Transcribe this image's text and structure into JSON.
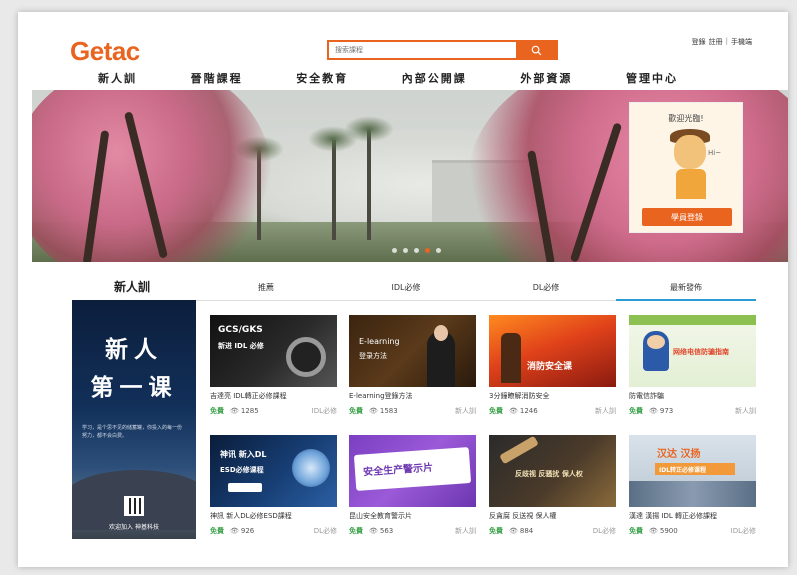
{
  "header": {
    "logo": "Getac",
    "search_placeholder": "搜索課程",
    "user_links": [
      "登錄",
      "註冊",
      "手機端"
    ]
  },
  "nav": [
    "新人訓",
    "晉階課程",
    "安全教育",
    "內部公開課",
    "外部資源",
    "管理中心"
  ],
  "banner": {
    "welcome_title": "歡迎光臨!",
    "hi": "Hi~",
    "login_button": "學員登錄",
    "dots": 5,
    "active_dot": 3
  },
  "section": {
    "title": "新人訓",
    "tabs": [
      "推薦",
      "IDL必修",
      "DL必修",
      "最新發佈"
    ],
    "active_tab": 3
  },
  "poster": {
    "line1": "新人",
    "line2": "第一课",
    "small_text": "学习，是个思不见的储蓄罐，你投入的每一份努力，都不会白费。",
    "footer": "欢迎加入  神基科技"
  },
  "courses": [
    {
      "title": "吉達亮 IDL轉正必修課程",
      "price": "免費",
      "views": "1285",
      "category": "IDL必修",
      "thumb_line1": "GCS/GKS",
      "thumb_line2": "新进 IDL 必修"
    },
    {
      "title": "E-learning登錄方法",
      "price": "免費",
      "views": "1583",
      "category": "新人訓",
      "thumb_line1": "E-learning",
      "thumb_line2": "登录方法"
    },
    {
      "title": "3分鐘瞭解消防安全",
      "price": "免費",
      "views": "1246",
      "category": "新人訓",
      "thumb_line1": "消防安全课",
      "thumb_line2": ""
    },
    {
      "title": "防電信詐騙",
      "price": "免費",
      "views": "973",
      "category": "新人訓",
      "thumb_line1": "网络电信防骗指南",
      "thumb_line2": ""
    },
    {
      "title": "神訊 新人DL必修ESD課程",
      "price": "免費",
      "views": "926",
      "category": "DL必修",
      "thumb_line1": "神讯 新入DL",
      "thumb_line2": "ESD必修课程"
    },
    {
      "title": "昆山安全教育警示片",
      "price": "免費",
      "views": "563",
      "category": "新人訓",
      "thumb_line1": "安全生产警示片",
      "thumb_line2": ""
    },
    {
      "title": "反貪腐 反送視 保人權",
      "price": "免費",
      "views": "884",
      "category": "DL必修",
      "thumb_line1": "反歧视 反骚扰 保人权",
      "thumb_line2": ""
    },
    {
      "title": "漢達 漢揚 IDL 轉正必修課程",
      "price": "免費",
      "views": "5900",
      "category": "IDL必修",
      "thumb_line1": "汉达 汉扬",
      "thumb_line2": "IDL转正必修课程"
    }
  ],
  "colors": {
    "accent": "#e9641f",
    "free": "#3aa24a",
    "tab_active": "#2b9bd6"
  }
}
